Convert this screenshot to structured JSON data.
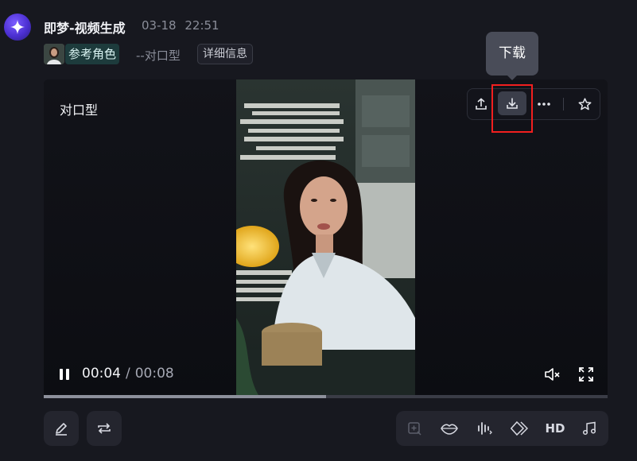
{
  "header": {
    "app_name": "即梦-视频生成",
    "date": "03-18",
    "time": "22:51",
    "reference_label": "参考角色",
    "mode_label": "--对口型",
    "detail_button": "详细信息"
  },
  "player": {
    "title": "对口型",
    "current_time": "00:04",
    "separator": "/",
    "total_time": "00:08",
    "progress": 0.5,
    "tooltip": "下载"
  },
  "top_actions": [
    "share-icon",
    "download-icon",
    "more-icon",
    "star-icon"
  ],
  "bottom_tools": {
    "hd_label": "HD"
  },
  "colors": {
    "accent": "#6b4cff",
    "highlight": "#f21f1f",
    "reference_bg": "#1d3b3c"
  }
}
